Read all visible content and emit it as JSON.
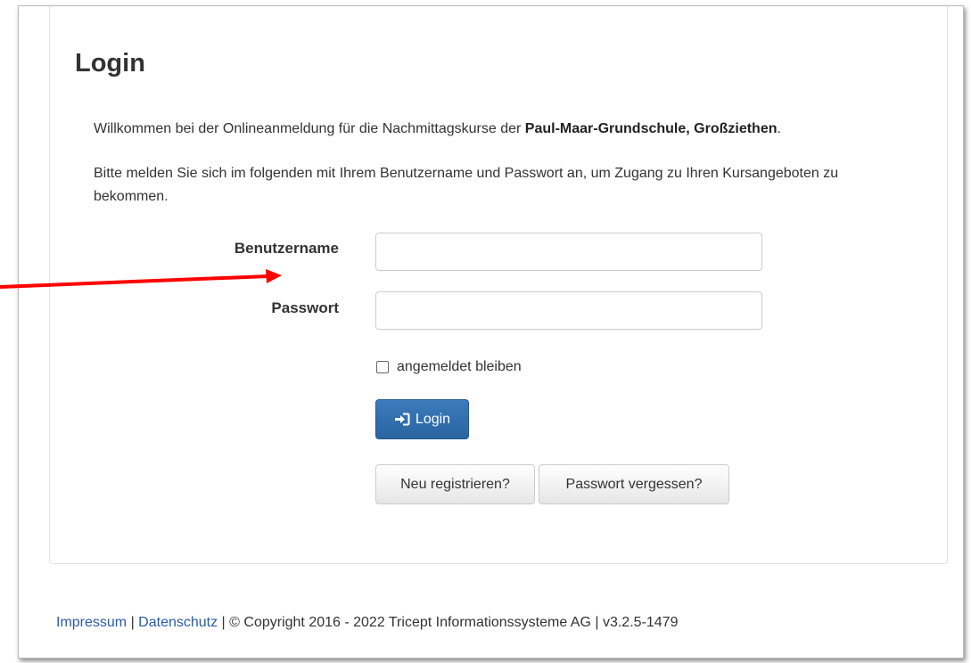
{
  "page": {
    "title": "Login",
    "intro_prefix": "Willkommen bei der Onlineanmeldung für die Nachmittagskurse der ",
    "intro_school": "Paul-Maar-Grundschule, Großziethen",
    "intro_suffix": ".",
    "instructions": "Bitte melden Sie sich im folgenden mit Ihrem Benutzername und Passwort an, um Zugang zu Ihren Kursangeboten zu bekommen."
  },
  "form": {
    "username_label": "Benutzername",
    "username_value": "",
    "password_label": "Passwort",
    "password_value": "",
    "remember_label": "angemeldet bleiben",
    "remember_checked": false,
    "login_button": "Login",
    "register_button": "Neu registrieren?",
    "forgot_button": "Passwort vergessen?"
  },
  "footer": {
    "impressum": "Impressum",
    "sep1": " | ",
    "datenschutz": "Datenschutz",
    "copyright": " | © Copyright 2016 - 2022 Tricept Informationssysteme AG | v3.2.5-1479"
  },
  "colors": {
    "primary_button": "#2f6ead",
    "link": "#2a5ca8",
    "annotation_arrow": "#ff0000"
  },
  "icons": {
    "login": "sign-in-icon"
  }
}
